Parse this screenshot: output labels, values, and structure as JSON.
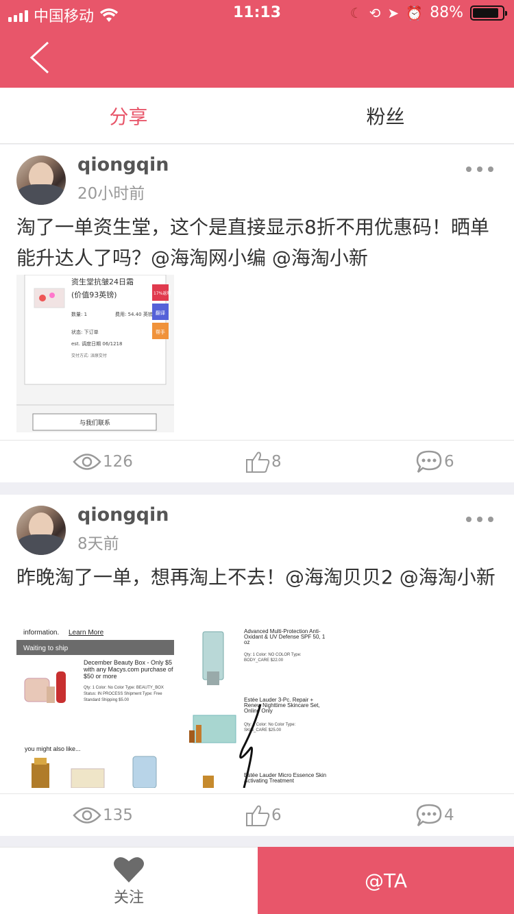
{
  "status_bar": {
    "carrier": "中国移动",
    "time": "11:13",
    "battery": "88%"
  },
  "nav": {
    "back_icon": "chevron-left-icon"
  },
  "tabs": [
    {
      "label": "分享",
      "active": true
    },
    {
      "label": "粉丝",
      "active": false
    }
  ],
  "posts": [
    {
      "user": "qiongqin",
      "time": "20小时前",
      "text": "淘了一单资生堂，这个是直接显示8折不用优惠码！晒单能升达人了吗？@海淘网小编 @海淘小新",
      "image": {
        "title": "资生堂抗皱24日霜",
        "subtitle": "(价值93英镑)",
        "qty": "数量: 1",
        "fee": "费用: 54.40 英镑",
        "state": "状态: 下订单",
        "date": "est. 调度日期 06/1218",
        "pay": "交付方式: 派原交付",
        "badges": [
          "17%返利",
          "翻译",
          "帮手"
        ],
        "contact": "与我们联系"
      },
      "views": "126",
      "likes": "8",
      "comments": "6"
    },
    {
      "user": "qiongqin",
      "time": "8天前",
      "text": "昨晚淘了一单，想再淘上不去！@海淘贝贝2 @海淘小新",
      "image": {
        "info": "information.",
        "learn_more": "Learn More",
        "waiting": "Waiting to ship",
        "box_title": "December Beauty Box - Only $5 with any Macys.com purchase of $50 or more",
        "box_details": "Qty: 1  Color: No Color  Type: BEAUTY_BOX  Status: IN PROCESS  Shipment Type: Free Standard Shipping  $5.00",
        "also_like": "you might also like...",
        "r1_title": "Advanced Multi-Protection Anti-Oxidant & UV Defense SPF 50, 1 oz",
        "r1_details": "Qty: 1  Color: NO COLOR  Type: BODY_CARE  $22.00",
        "r2_title": "Estée Lauder 3-Pc. Repair + Renew Nighttime Skincare Set, Online Only",
        "r2_details": "Qty: 1  Color: No Color  Type: SKIN_CARE  $25.00",
        "r3_title": "Estée Lauder Micro Essence Skin Activating Treatment"
      },
      "views": "135",
      "likes": "6",
      "comments": "4"
    }
  ],
  "footer": {
    "follow_label": "关注",
    "at_label": "@TA"
  },
  "colors": {
    "accent": "#e8566a",
    "muted": "#999999"
  }
}
